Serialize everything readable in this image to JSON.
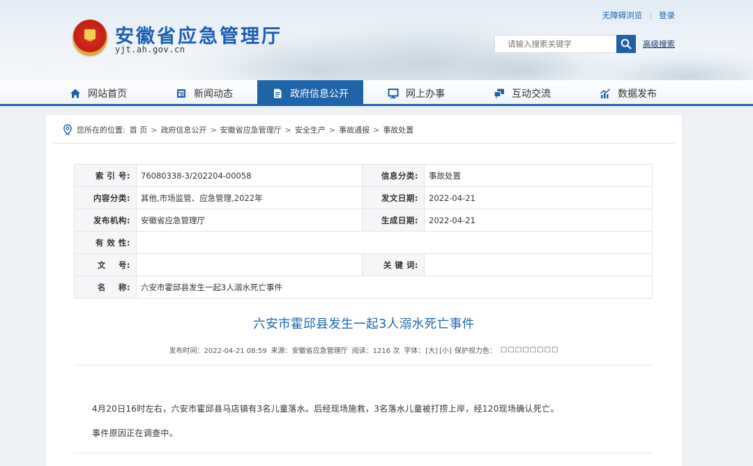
{
  "header": {
    "site_title": "安徽省应急管理厅",
    "site_domain": "yjt.ah.gov.cn",
    "top_links": {
      "accessibility": "无障碍浏览",
      "login": "登录"
    },
    "search": {
      "placeholder": "请输入搜索关键字",
      "advanced": "高级搜索"
    }
  },
  "nav": {
    "items": [
      {
        "label": "网站首页",
        "icon": "home-icon"
      },
      {
        "label": "新闻动态",
        "icon": "news-icon"
      },
      {
        "label": "政府信息公开",
        "icon": "document-icon",
        "active": true
      },
      {
        "label": "网上办事",
        "icon": "monitor-icon"
      },
      {
        "label": "互动交流",
        "icon": "chat-icon"
      },
      {
        "label": "数据发布",
        "icon": "chart-icon"
      }
    ],
    "accent_color": "#1f63ab"
  },
  "breadcrumb": {
    "prefix": "您所在的位置:",
    "items": [
      "首 页",
      "政府信息公开",
      "安徽省应急管理厅",
      "安全生产",
      "事故通报",
      "事故处置"
    ],
    "separator": ">"
  },
  "info_table": {
    "index_label": "索 引 号:",
    "index_value": "76080338-3/202204-00058",
    "category_label": "信息分类:",
    "category_value": "事故处置",
    "content_label": "内容分类:",
    "content_value": "其他,市场监管、应急管理,2022年",
    "issue_date_label": "发文日期:",
    "issue_date_value": "2022-04-21",
    "publisher_label": "发布机构:",
    "publisher_value": "安徽省应急管理厅",
    "created_label": "生成日期:",
    "created_value": "2022-04-21",
    "validity_label": "有 效 性:",
    "validity_value": "",
    "docno_label": "文    号:",
    "docno_value": "",
    "keywords_label": "关 键 词:",
    "keywords_value": "",
    "name_label": "名    称:",
    "name_value": "六安市霍邱县发生一起3人溺水死亡事件"
  },
  "article": {
    "title": "六安市霍邱县发生一起3人溺水死亡事件",
    "meta": {
      "publish_time": "发布时间：2022-04-21 08:59",
      "source": "来源：安徽省应急管理厅",
      "reads": "阅读：1216 次",
      "font_label": "字体：",
      "font_large": "[大]",
      "font_small": "[小]",
      "eye_care_label": "保护视力色：",
      "eye_care_blocks": "□□□□□□□□"
    },
    "paragraphs": [
      "4月20日16时左右，六安市霍邱县马店镇有3名儿童落水。后经现场施救，3名落水儿童被打捞上岸，经120现场确认死亡。",
      "事件原因正在调查中。"
    ]
  }
}
